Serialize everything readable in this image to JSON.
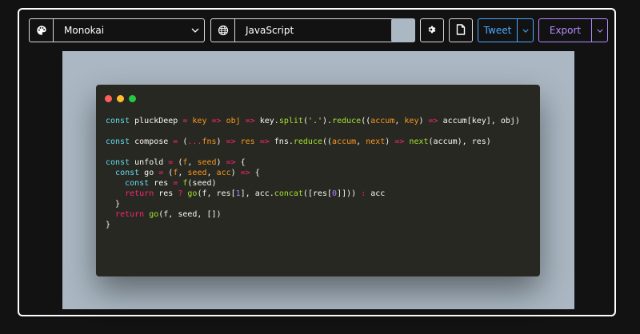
{
  "toolbar": {
    "theme": {
      "label": "Monokai",
      "icon": "palette-icon"
    },
    "language": {
      "label": "JavaScript",
      "icon": "globe-icon"
    },
    "background_color": "#abb8c3",
    "settings_icon": "gear-icon",
    "copy_icon": "document-icon",
    "tweet": {
      "label": "Tweet",
      "color": "#4aa8ff"
    },
    "export": {
      "label": "Export",
      "color": "#b68cff"
    }
  },
  "editor": {
    "window_controls": [
      "#ff5f56",
      "#ffbd2e",
      "#27c93f"
    ],
    "code_lines": [
      [
        {
          "t": "const",
          "c": "c"
        },
        {
          "t": " pluckDeep ",
          "c": "p"
        },
        {
          "t": "=",
          "c": "k"
        },
        {
          "t": " ",
          "c": "p"
        },
        {
          "t": "key",
          "c": "v"
        },
        {
          "t": " ",
          "c": "p"
        },
        {
          "t": "=>",
          "c": "k"
        },
        {
          "t": " ",
          "c": "p"
        },
        {
          "t": "obj",
          "c": "v"
        },
        {
          "t": " ",
          "c": "p"
        },
        {
          "t": "=>",
          "c": "k"
        },
        {
          "t": " key.",
          "c": "p"
        },
        {
          "t": "split",
          "c": "f"
        },
        {
          "t": "(",
          "c": "p"
        },
        {
          "t": "'.'",
          "c": "s"
        },
        {
          "t": ").",
          "c": "p"
        },
        {
          "t": "reduce",
          "c": "f"
        },
        {
          "t": "((",
          "c": "p"
        },
        {
          "t": "accum",
          "c": "v"
        },
        {
          "t": ", ",
          "c": "p"
        },
        {
          "t": "key",
          "c": "v"
        },
        {
          "t": ") ",
          "c": "p"
        },
        {
          "t": "=>",
          "c": "k"
        },
        {
          "t": " accum[key], obj)",
          "c": "p"
        }
      ],
      [],
      [
        {
          "t": "const",
          "c": "c"
        },
        {
          "t": " compose ",
          "c": "p"
        },
        {
          "t": "=",
          "c": "k"
        },
        {
          "t": " (",
          "c": "p"
        },
        {
          "t": "...",
          "c": "k"
        },
        {
          "t": "fns",
          "c": "v"
        },
        {
          "t": ") ",
          "c": "p"
        },
        {
          "t": "=>",
          "c": "k"
        },
        {
          "t": " ",
          "c": "p"
        },
        {
          "t": "res",
          "c": "v"
        },
        {
          "t": " ",
          "c": "p"
        },
        {
          "t": "=>",
          "c": "k"
        },
        {
          "t": " fns.",
          "c": "p"
        },
        {
          "t": "reduce",
          "c": "f"
        },
        {
          "t": "((",
          "c": "p"
        },
        {
          "t": "accum",
          "c": "v"
        },
        {
          "t": ", ",
          "c": "p"
        },
        {
          "t": "next",
          "c": "v"
        },
        {
          "t": ") ",
          "c": "p"
        },
        {
          "t": "=>",
          "c": "k"
        },
        {
          "t": " ",
          "c": "p"
        },
        {
          "t": "next",
          "c": "f"
        },
        {
          "t": "(accum), res)",
          "c": "p"
        }
      ],
      [],
      [
        {
          "t": "const",
          "c": "c"
        },
        {
          "t": " unfold ",
          "c": "p"
        },
        {
          "t": "=",
          "c": "k"
        },
        {
          "t": " (",
          "c": "p"
        },
        {
          "t": "f",
          "c": "v"
        },
        {
          "t": ", ",
          "c": "p"
        },
        {
          "t": "seed",
          "c": "v"
        },
        {
          "t": ") ",
          "c": "p"
        },
        {
          "t": "=>",
          "c": "k"
        },
        {
          "t": " {",
          "c": "p"
        }
      ],
      [
        {
          "t": "  ",
          "c": "p"
        },
        {
          "t": "const",
          "c": "c"
        },
        {
          "t": " go ",
          "c": "p"
        },
        {
          "t": "=",
          "c": "k"
        },
        {
          "t": " (",
          "c": "p"
        },
        {
          "t": "f",
          "c": "v"
        },
        {
          "t": ", ",
          "c": "p"
        },
        {
          "t": "seed",
          "c": "v"
        },
        {
          "t": ", ",
          "c": "p"
        },
        {
          "t": "acc",
          "c": "v"
        },
        {
          "t": ") ",
          "c": "p"
        },
        {
          "t": "=>",
          "c": "k"
        },
        {
          "t": " {",
          "c": "p"
        }
      ],
      [
        {
          "t": "    ",
          "c": "p"
        },
        {
          "t": "const",
          "c": "c"
        },
        {
          "t": " res ",
          "c": "p"
        },
        {
          "t": "=",
          "c": "k"
        },
        {
          "t": " ",
          "c": "p"
        },
        {
          "t": "f",
          "c": "f"
        },
        {
          "t": "(seed)",
          "c": "p"
        }
      ],
      [
        {
          "t": "    ",
          "c": "p"
        },
        {
          "t": "return",
          "c": "k"
        },
        {
          "t": " res ",
          "c": "p"
        },
        {
          "t": "?",
          "c": "k"
        },
        {
          "t": " ",
          "c": "p"
        },
        {
          "t": "go",
          "c": "f"
        },
        {
          "t": "(f, res[",
          "c": "p"
        },
        {
          "t": "1",
          "c": "n"
        },
        {
          "t": "], acc.",
          "c": "p"
        },
        {
          "t": "concat",
          "c": "f"
        },
        {
          "t": "([res[",
          "c": "p"
        },
        {
          "t": "0",
          "c": "n"
        },
        {
          "t": "]])) ",
          "c": "p"
        },
        {
          "t": ":",
          "c": "k"
        },
        {
          "t": " acc",
          "c": "p"
        }
      ],
      [
        {
          "t": "  }",
          "c": "p"
        }
      ],
      [
        {
          "t": "  ",
          "c": "p"
        },
        {
          "t": "return",
          "c": "k"
        },
        {
          "t": " ",
          "c": "p"
        },
        {
          "t": "go",
          "c": "f"
        },
        {
          "t": "(f, seed, [])",
          "c": "p"
        }
      ],
      [
        {
          "t": "}",
          "c": "p"
        }
      ]
    ]
  }
}
